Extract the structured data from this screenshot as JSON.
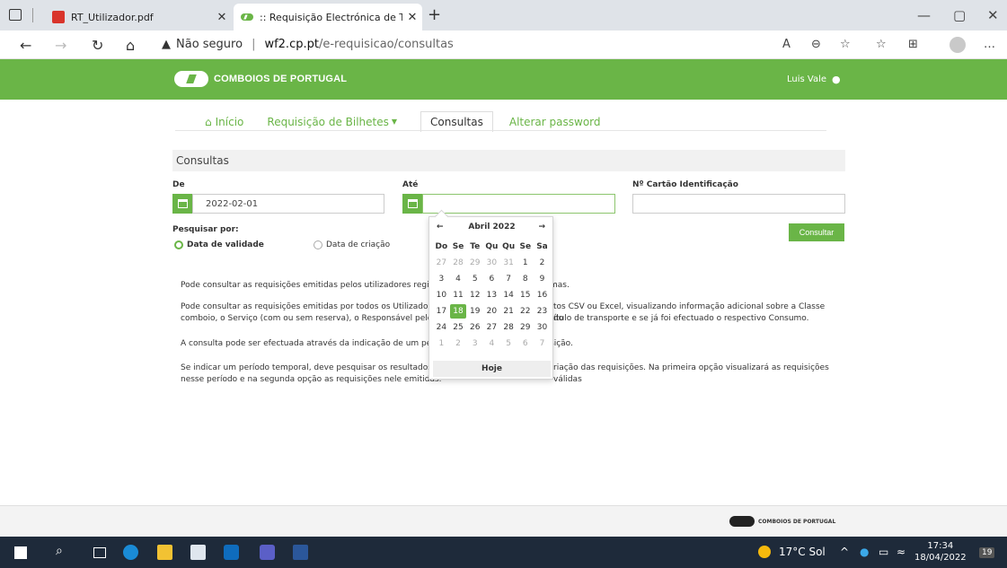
{
  "browser": {
    "tabs": [
      {
        "title": "RT_Utilizador.pdf"
      },
      {
        "title": ":: Requisição Electrónica de Trans"
      }
    ],
    "address": {
      "security": "Não seguro",
      "host": "wf2.cp.pt",
      "path": "/e-requisicao/consultas"
    }
  },
  "header": {
    "brand": "COMBOIOS DE PORTUGAL",
    "user": "Luis Vale"
  },
  "nav": {
    "home": "Início",
    "requisicao": "Requisição de Bilhetes",
    "consultas": "Consultas",
    "password": "Alterar password"
  },
  "form": {
    "panel_title": "Consultas",
    "de_label": "De",
    "de_value": "2022-02-01",
    "ate_label": "Até",
    "ate_value": "",
    "cartao_label": "Nº Cartão Identificação",
    "cartao_value": "",
    "pesquisar_label": "Pesquisar por:",
    "radio_validade": "Data de validade",
    "radio_criacao": "Data de criação",
    "submit": "Consultar"
  },
  "datepicker": {
    "prev": "←",
    "next": "→",
    "month": "Abril 2022",
    "weekdays": [
      "Do",
      "Se",
      "Te",
      "Qu",
      "Qu",
      "Se",
      "Sa"
    ],
    "weeks": [
      [
        {
          "d": "27",
          "o": true
        },
        {
          "d": "28",
          "o": true
        },
        {
          "d": "29",
          "o": true
        },
        {
          "d": "30",
          "o": true
        },
        {
          "d": "31",
          "o": true
        },
        {
          "d": "1"
        },
        {
          "d": "2"
        }
      ],
      [
        {
          "d": "3"
        },
        {
          "d": "4"
        },
        {
          "d": "5"
        },
        {
          "d": "6"
        },
        {
          "d": "7"
        },
        {
          "d": "8"
        },
        {
          "d": "9"
        }
      ],
      [
        {
          "d": "10"
        },
        {
          "d": "11"
        },
        {
          "d": "12"
        },
        {
          "d": "13"
        },
        {
          "d": "14"
        },
        {
          "d": "15"
        },
        {
          "d": "16"
        }
      ],
      [
        {
          "d": "17"
        },
        {
          "d": "18",
          "t": true
        },
        {
          "d": "19"
        },
        {
          "d": "20"
        },
        {
          "d": "21"
        },
        {
          "d": "22"
        },
        {
          "d": "23"
        }
      ],
      [
        {
          "d": "24"
        },
        {
          "d": "25"
        },
        {
          "d": "26"
        },
        {
          "d": "27"
        },
        {
          "d": "28"
        },
        {
          "d": "29"
        },
        {
          "d": "30"
        }
      ],
      [
        {
          "d": "1",
          "o": true
        },
        {
          "d": "2",
          "o": true
        },
        {
          "d": "3",
          "o": true
        },
        {
          "d": "4",
          "o": true
        },
        {
          "d": "5",
          "o": true
        },
        {
          "d": "6",
          "o": true
        },
        {
          "d": "7",
          "o": true
        }
      ]
    ],
    "today_label": "Hoje"
  },
  "info": {
    "p1a": "Pode consultar as requisições emitidas pelos utilizadores registados",
    "p1b": "mas.",
    "p2a": "Pode consultar as requisições emitidas por todos os Utilizadores re",
    "p2b": "tos CSV ou Excel, visualizando informação adicional sobre a Classe do",
    "p2c": "comboio, o Serviço (com ou sem reserva), o Responsável pelo levan",
    "p2d": "título de transporte e se já foi efectuado o respectivo Consumo.",
    "p3a": "A consulta pode ser efectuada através da indicação de um período",
    "p3b": "sição.",
    "p4a": "Se indicar um período temporal, deve pesquisar os resultados por",
    "p4b": "riação das requisições. Na primeira opção visualizará as requisições válidas",
    "p4c": "nesse período e na segunda opção as requisições nele emitidas."
  },
  "footer": {
    "brand": "COMBOIOS DE PORTUGAL"
  },
  "taskbar": {
    "weather": "17°C Sol",
    "time": "17:34",
    "date": "18/04/2022",
    "notifications": "19"
  },
  "colors": {
    "brand_green": "#6ab547",
    "taskbar": "#1e2a3a"
  }
}
